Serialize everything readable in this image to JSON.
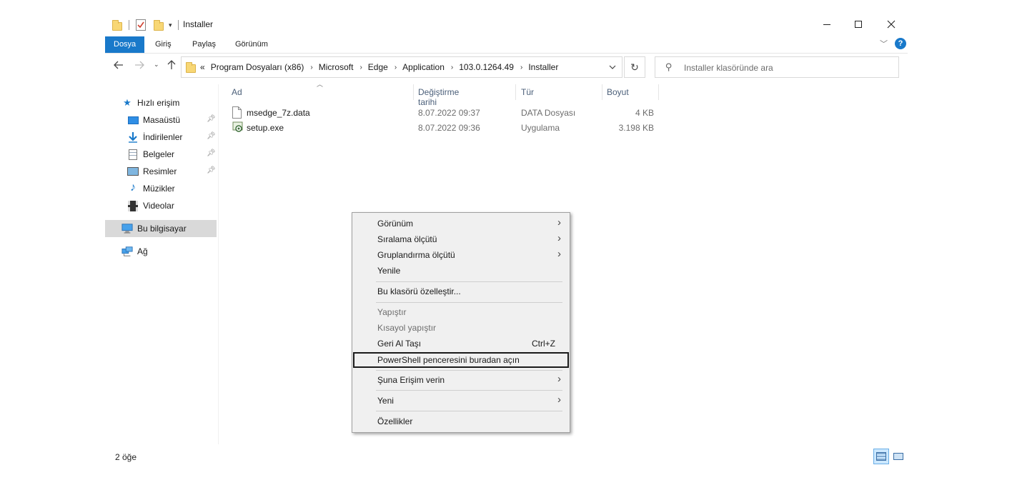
{
  "window": {
    "title": "Installer",
    "controls": {
      "minimize": "—",
      "maximize": "☐",
      "close": "✕"
    }
  },
  "ribbon": {
    "tabs": [
      {
        "label": "Dosya",
        "active": true
      },
      {
        "label": "Giriş",
        "active": false
      },
      {
        "label": "Paylaş",
        "active": false
      },
      {
        "label": "Görünüm",
        "active": false
      }
    ],
    "help": "?",
    "accent": "#1979ca"
  },
  "address": {
    "overflow": "«",
    "crumbs": [
      "Program Dosyaları (x86)",
      "Microsoft",
      "Edge",
      "Application",
      "103.0.1264.49",
      "Installer"
    ],
    "separator": "›"
  },
  "search": {
    "placeholder": "Installer klasöründe ara"
  },
  "nav": {
    "quick_access": "Hızlı erişim",
    "items": [
      {
        "label": "Masaüstü",
        "pinned": true,
        "icon": "desktop-icon"
      },
      {
        "label": "İndirilenler",
        "pinned": true,
        "icon": "downloads-icon"
      },
      {
        "label": "Belgeler",
        "pinned": true,
        "icon": "documents-icon"
      },
      {
        "label": "Resimler",
        "pinned": true,
        "icon": "pictures-icon"
      },
      {
        "label": "Müzikler",
        "pinned": false,
        "icon": "music-icon"
      },
      {
        "label": "Videolar",
        "pinned": false,
        "icon": "videos-icon"
      }
    ],
    "this_pc": "Bu bilgisayar",
    "network": "Ağ"
  },
  "files": {
    "columns": {
      "name": "Ad",
      "date": "Değiştirme tarihi",
      "type": "Tür",
      "size": "Boyut"
    },
    "rows": [
      {
        "name": "msedge_7z.data",
        "date": "8.07.2022 09:37",
        "type": "DATA Dosyası",
        "size": "4 KB",
        "icon": "file-icon"
      },
      {
        "name": "setup.exe",
        "date": "8.07.2022 09:36",
        "type": "Uygulama",
        "size": "3.198 KB",
        "icon": "setup-icon"
      }
    ]
  },
  "status": {
    "count": "2 öğe"
  },
  "context_menu": {
    "items": [
      {
        "label": "Görünüm",
        "submenu": true
      },
      {
        "label": "Sıralama ölçütü",
        "submenu": true
      },
      {
        "label": "Gruplandırma ölçütü",
        "submenu": true
      },
      {
        "label": "Yenile"
      },
      {
        "label": "Bu klasörü özelleştir..."
      },
      {
        "label": "Yapıştır",
        "disabled": true
      },
      {
        "label": "Kısayol yapıştır",
        "disabled": true
      },
      {
        "label": "Geri Al Taşı",
        "shortcut": "Ctrl+Z"
      },
      {
        "label": "PowerShell penceresini buradan açın",
        "focused": true
      },
      {
        "label": "Şuna Erişim verin",
        "submenu": true
      },
      {
        "label": "Yeni",
        "submenu": true
      },
      {
        "label": "Özellikler"
      }
    ]
  }
}
